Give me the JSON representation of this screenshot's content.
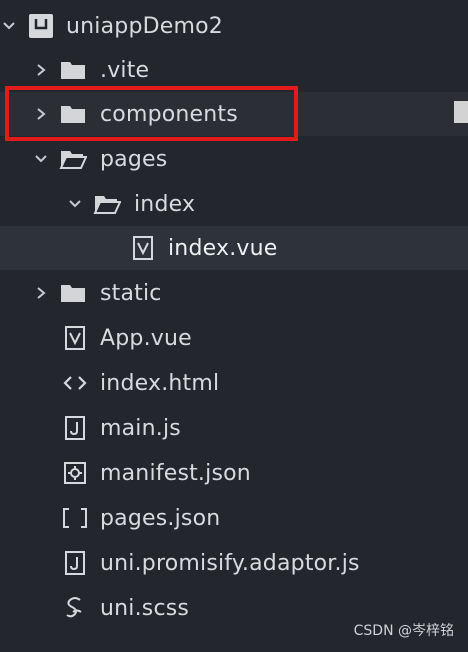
{
  "tree": {
    "root": {
      "label": "uniappDemo2",
      "icon": "project-icon",
      "expanded": true
    },
    "items": [
      {
        "label": ".vite",
        "icon": "folder-icon",
        "type": "folder",
        "expanded": false
      },
      {
        "label": "components",
        "icon": "folder-icon",
        "type": "folder",
        "expanded": false
      },
      {
        "label": "pages",
        "icon": "folder-open-icon",
        "type": "folder",
        "expanded": true
      },
      {
        "label": "index",
        "icon": "folder-open-icon",
        "type": "folder",
        "expanded": true
      },
      {
        "label": "index.vue",
        "icon": "vue-file-icon",
        "type": "file",
        "selected": true
      },
      {
        "label": "static",
        "icon": "folder-icon",
        "type": "folder",
        "expanded": false
      },
      {
        "label": "App.vue",
        "icon": "vue-file-icon",
        "type": "file"
      },
      {
        "label": "index.html",
        "icon": "html-file-icon",
        "type": "file"
      },
      {
        "label": "main.js",
        "icon": "js-file-icon",
        "type": "file"
      },
      {
        "label": "manifest.json",
        "icon": "manifest-file-icon",
        "type": "file"
      },
      {
        "label": "pages.json",
        "icon": "json-file-icon",
        "type": "file"
      },
      {
        "label": "uni.promisify.adaptor.js",
        "icon": "js-file-icon",
        "type": "file"
      },
      {
        "label": "uni.scss",
        "icon": "scss-file-icon",
        "type": "file"
      }
    ]
  },
  "watermark": "CSDN @岑梓铭",
  "colors": {
    "background": "#23262c",
    "text": "#d8dadd",
    "highlight": "#e51a1a",
    "selected_row": "#2e323a"
  }
}
